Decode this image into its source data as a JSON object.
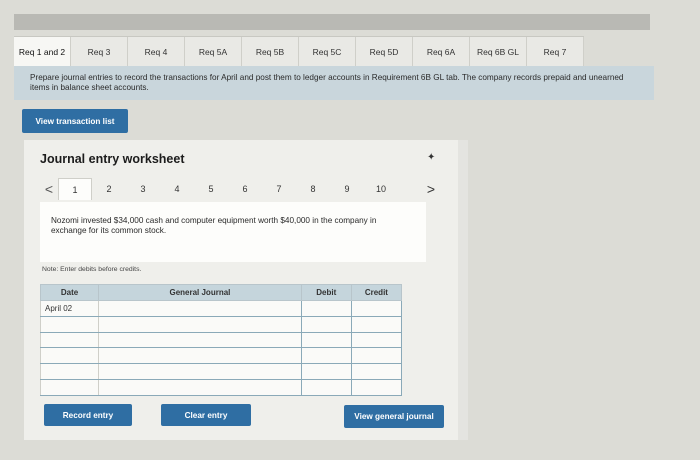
{
  "tabs": [
    {
      "label": "Req 1 and 2",
      "active": true
    },
    {
      "label": "Req 3"
    },
    {
      "label": "Req 4"
    },
    {
      "label": "Req 5A"
    },
    {
      "label": "Req 5B"
    },
    {
      "label": "Req 5C"
    },
    {
      "label": "Req 5D"
    },
    {
      "label": "Req 6A"
    },
    {
      "label": "Req 6B GL"
    },
    {
      "label": "Req 7"
    }
  ],
  "instructions": "Prepare journal entries to record the transactions for April and post them to ledger accounts in Requirement 6B GL tab. The company records prepaid and unearned items in balance sheet accounts.",
  "view_transaction_list_label": "View transaction list",
  "worksheet": {
    "title": "Journal entry worksheet",
    "pager": {
      "prev": "<",
      "next": ">",
      "pages": [
        "1",
        "2",
        "3",
        "4",
        "5",
        "6",
        "7",
        "8",
        "9",
        "10"
      ],
      "active_page": "1"
    },
    "description": "Nozomi invested $34,000 cash and computer equipment worth $40,000 in the company in exchange for its common stock.",
    "note": "Note: Enter debits before credits.",
    "table": {
      "headers": {
        "date": "Date",
        "account": "General Journal",
        "debit": "Debit",
        "credit": "Credit"
      },
      "first_date": "April 02"
    },
    "buttons": {
      "record": "Record entry",
      "clear": "Clear entry",
      "view_general_journal": "View general journal"
    }
  },
  "colors": {
    "button_blue": "#2f6ea3",
    "instruction_bg": "#c9d6dc",
    "table_header_bg": "#c5d5dc"
  }
}
